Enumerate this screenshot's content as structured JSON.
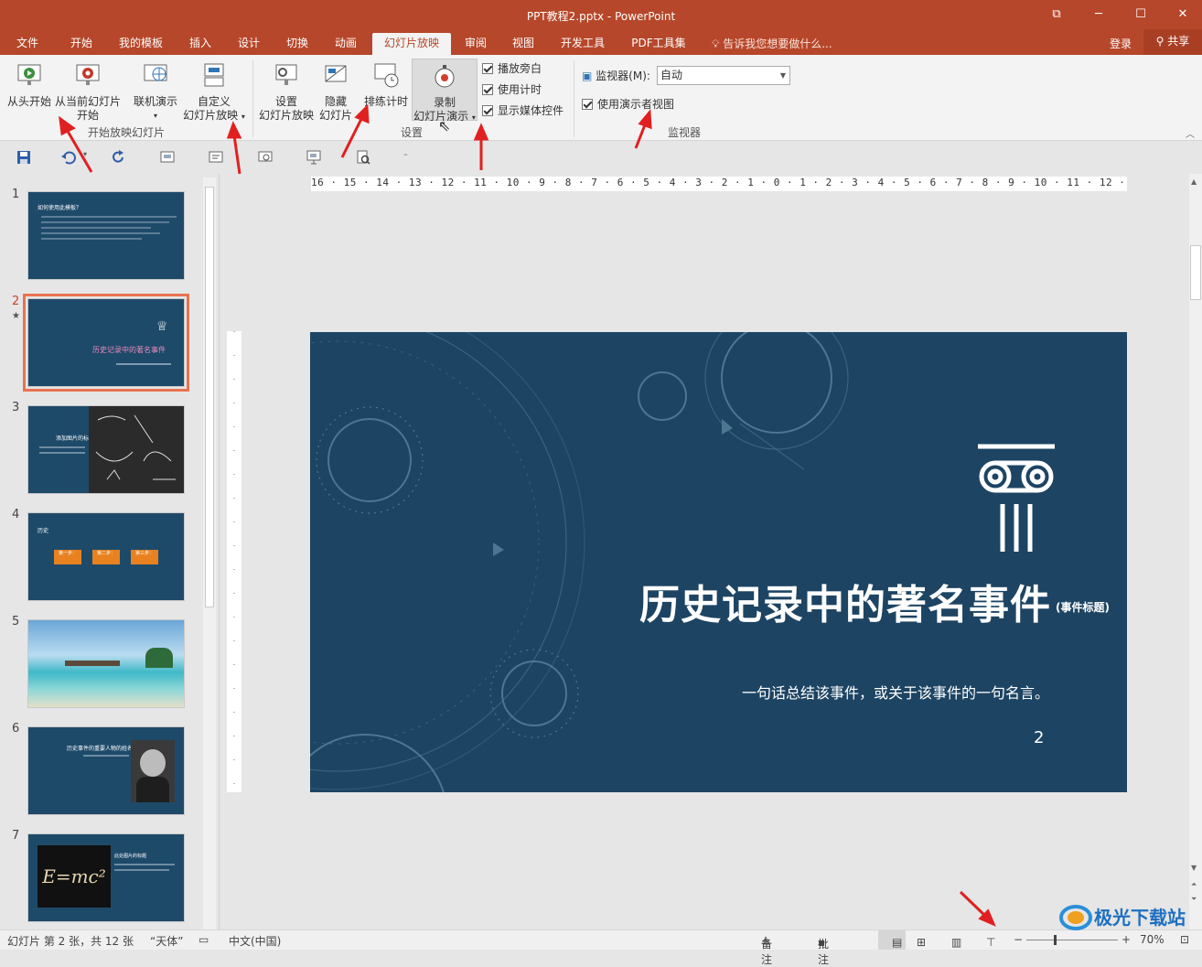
{
  "window": {
    "title": "PPT教程2.pptx - PowerPoint"
  },
  "tabs": [
    "文件",
    "开始",
    "我的模板",
    "插入",
    "设计",
    "切换",
    "动画",
    "幻灯片放映",
    "审阅",
    "视图",
    "开发工具",
    "PDF工具集"
  ],
  "active_tab": "幻灯片放映",
  "tell_me": "告诉我您想要做什么...",
  "account": {
    "login": "登录",
    "share": "共享"
  },
  "ribbon": {
    "from_beginning": "从头开始",
    "from_current_1": "从当前幻灯片",
    "from_current_2": "开始",
    "online": "联机演示",
    "custom_1": "自定义",
    "custom_2": "幻灯片放映",
    "group_start": "开始放映幻灯片",
    "setup_1": "设置",
    "setup_2": "幻灯片放映",
    "hide_1": "隐藏",
    "hide_2": "幻灯片",
    "rehearse": "排练计时",
    "record_1": "录制",
    "record_2": "幻灯片演示",
    "chk_narration": "播放旁白",
    "chk_timing": "使用计时",
    "chk_media": "显示媒体控件",
    "group_setup": "设置",
    "monitor_label": "监视器(M):",
    "monitor_value": "自动",
    "presenter_view": "使用演示者视图",
    "group_monitor": "监视器"
  },
  "ruler_h": "16 · 15 · 14 · 13 · 12 · 11 · 10 · 9 · 8 · 7 · 6 · 5 · 4 · 3 · 2 · 1 · 0 · 1 · 2 · 3 · 4 · 5 · 6 · 7 · 8 · 9 · 10 · 11 · 12 · 13 · 14 · 15 · 16",
  "thumbnails": [
    {
      "num": "1"
    },
    {
      "num": "2"
    },
    {
      "num": "3"
    },
    {
      "num": "4"
    },
    {
      "num": "5"
    },
    {
      "num": "6"
    },
    {
      "num": "7"
    }
  ],
  "thumb_text": {
    "t1_title": "如何使用此模板？",
    "t2_title": "历史记录中的著名事件",
    "t3_title": "添加图片的标题",
    "t4_title": "历史",
    "t4_steps": [
      "第一步：",
      "第二步：",
      "第三步："
    ],
    "t6_title": "历史事件的重要人物的姓名",
    "t7_title": "此处图片的标题",
    "t7_formula": "E=mc²"
  },
  "slide": {
    "title": "历史记录中的著名事件",
    "tag": "(事件标题)",
    "subtitle": "一句话总结该事件，或关于该事件的一句名言。",
    "number": "2"
  },
  "status": {
    "slide_info": "幻灯片 第 2 张，共 12 张",
    "theme": "“天体”",
    "language": "中文(中国)",
    "notes": "备注",
    "comments": "批注",
    "zoom": "70%"
  },
  "watermark": "极光下载站"
}
